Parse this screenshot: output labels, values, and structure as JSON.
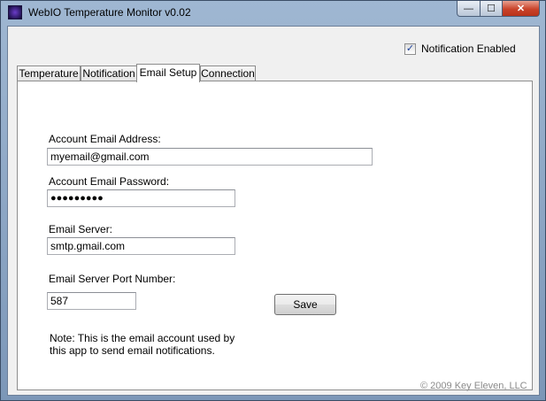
{
  "window": {
    "title": "WebIO Temperature Monitor   v0.02",
    "controls": {
      "minimize": "—",
      "maximize": "☐",
      "close": "✕"
    }
  },
  "notification_checkbox": {
    "label": "Notification Enabled",
    "checked": true,
    "check_glyph": "✓"
  },
  "tabs": [
    {
      "label": "Temperature",
      "active": false
    },
    {
      "label": "Notification",
      "active": false
    },
    {
      "label": "Email Setup",
      "active": true
    },
    {
      "label": "Connection",
      "active": false
    }
  ],
  "email_setup": {
    "account_email_label": "Account Email Address:",
    "account_email_value": "myemail@gmail.com",
    "password_label": "Account Email Password:",
    "password_value": "●●●●●●●●●",
    "server_label": "Email Server:",
    "server_value": "smtp.gmail.com",
    "port_label": "Email Server Port Number:",
    "port_value": "587",
    "save_label": "Save",
    "note_line1": "Note: This is the email account used by",
    "note_line2": "this app to send email notifications."
  },
  "footer": {
    "copyright": "© 2009 Key Eleven, LLC"
  }
}
